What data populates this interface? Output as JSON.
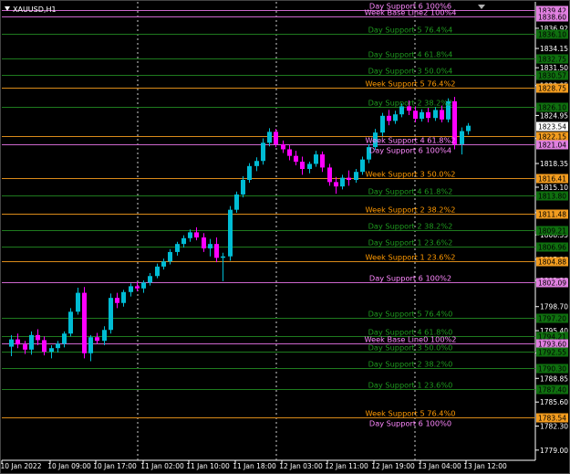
{
  "window": {
    "symbol_title": "XAUUSD,H1"
  },
  "colors": {
    "background": "#000000",
    "bull_candle": "#00bcd4",
    "bear_candle": "#ff00ff",
    "grid_vertical": "#cfcfcf",
    "axis_text": "#ffffff",
    "day_level": "#1e7a1e",
    "day_label": "#1f9a1f",
    "week_level": "#d98a1a",
    "week_label": "#ff9900",
    "day6_level": "#cc66cc",
    "day6_label": "#ff88ff",
    "current_price_box": "#ffffff"
  },
  "chart_data": {
    "type": "candlestick",
    "title": "XAUUSD,H1",
    "timeframe": "H1",
    "ylim": [
      1777.6,
      1840.55
    ],
    "price_axis_ticks": [
      1836.92,
      1834.15,
      1831.5,
      1829.05,
      1824.95,
      1821.78,
      1818.35,
      1815.1,
      1811.6,
      1808.55,
      1805.2,
      1802.3,
      1798.7,
      1795.4,
      1792.35,
      1788.85,
      1785.6,
      1782.3,
      1779.0
    ],
    "time_axis_ticks": [
      "10 Jan 2022",
      "10 Jan 09:00",
      "10 Jan 17:00",
      "11 Jan 02:00",
      "11 Jan 10:00",
      "11 Jan 18:00",
      "12 Jan 03:00",
      "12 Jan 11:00",
      "12 Jan 19:00",
      "13 Jan 04:00",
      "13 Jan 12:00"
    ],
    "current_price": 1823.54,
    "levels": [
      {
        "price": 1839.42,
        "label": "Day Support 6 100%6",
        "box": "1839.42",
        "kind": "day6"
      },
      {
        "price": 1838.6,
        "label": "Week Base Line2 100%4",
        "box": "1838.60",
        "kind": "day6"
      },
      {
        "price": 1836.1,
        "label": "Day Support 5 76.4%4",
        "box": "1836.10",
        "kind": "day"
      },
      {
        "price": 1832.8,
        "label": "Day Support 4 61.8%4",
        "box": "1832.75",
        "kind": "day"
      },
      {
        "price": 1830.5,
        "label": "Day Support 3 50.0%4",
        "box": "1830.57",
        "kind": "day"
      },
      {
        "price": 1828.75,
        "label": "Week Support 5 76.4%2",
        "box": "1828.75",
        "kind": "week"
      },
      {
        "price": 1826.1,
        "label": "Day Support 2 38.2%2",
        "box": "1826.10",
        "kind": "day"
      },
      {
        "price": 1822.15,
        "label": "",
        "box": "1822.15",
        "kind": "week"
      },
      {
        "price": 1821.04,
        "label": "Week Support 4 61.8%2",
        "box": "1821.04",
        "kind": "day6",
        "extra_label": "Day Support 6 100%4"
      },
      {
        "price": 1816.41,
        "label": "Week Support 3 50.0%2",
        "box": "1816.41",
        "kind": "week"
      },
      {
        "price": 1814.0,
        "label": "Day Support 4 61.8%2",
        "box": "1813.80",
        "kind": "day"
      },
      {
        "price": 1811.48,
        "label": "Week Support 2 38.2%2",
        "box": "1811.48",
        "kind": "week"
      },
      {
        "price": 1809.2,
        "label": "Day Support 2 38.2%2",
        "box": "1809.21",
        "kind": "day"
      },
      {
        "price": 1806.9,
        "label": "Day Support 1 23.6%2",
        "box": "1806.96",
        "kind": "day"
      },
      {
        "price": 1804.88,
        "label": "Week Support 1 23.6%2",
        "box": "1804.88",
        "kind": "week"
      },
      {
        "price": 1802.09,
        "label": "Day Support 6 100%2",
        "box": "1802.09",
        "kind": "day6"
      },
      {
        "price": 1797.2,
        "label": "Day Support 5 76.4%0",
        "box": "1797.20",
        "kind": "day"
      },
      {
        "price": 1794.7,
        "label": "Day Support 4 61.8%0",
        "box": "1794.21",
        "kind": "day"
      },
      {
        "price": 1793.6,
        "label": "Week Base Line0 100%2",
        "box": "1793.60",
        "kind": "day6"
      },
      {
        "price": 1792.5,
        "label": "Day Support 3 50.0%0",
        "box": "1792.55",
        "kind": "day"
      },
      {
        "price": 1790.3,
        "label": "Day Support 2 38.2%0",
        "box": "1790.30",
        "kind": "day"
      },
      {
        "price": 1787.4,
        "label": "Day Support 1 23.6%0",
        "box": "1787.40",
        "kind": "day"
      },
      {
        "price": 1783.54,
        "label": "Week Support 5 76.4%0",
        "box": "1783.54",
        "kind": "week",
        "extra_label": "Day Support 6 100%0"
      }
    ],
    "candles": [
      [
        1793.2,
        1794.8,
        1791.9,
        1794.2
      ],
      [
        1794.2,
        1795.0,
        1793.0,
        1793.5
      ],
      [
        1793.5,
        1794.0,
        1792.2,
        1792.8
      ],
      [
        1792.8,
        1795.3,
        1792.1,
        1794.8
      ],
      [
        1794.8,
        1795.6,
        1793.4,
        1794.1
      ],
      [
        1794.1,
        1794.6,
        1792.0,
        1792.5
      ],
      [
        1792.5,
        1793.4,
        1791.6,
        1793.0
      ],
      [
        1793.0,
        1794.0,
        1792.4,
        1793.6
      ],
      [
        1793.6,
        1795.3,
        1793.1,
        1795.0
      ],
      [
        1795.0,
        1798.5,
        1794.6,
        1798.0
      ],
      [
        1798.0,
        1801.3,
        1797.6,
        1800.6
      ],
      [
        1800.6,
        1801.4,
        1791.6,
        1792.3
      ],
      [
        1792.3,
        1794.8,
        1791.2,
        1794.5
      ],
      [
        1794.5,
        1795.1,
        1793.6,
        1794.0
      ],
      [
        1794.0,
        1796.0,
        1793.4,
        1795.5
      ],
      [
        1795.5,
        1800.5,
        1795.0,
        1799.9
      ],
      [
        1799.9,
        1800.6,
        1798.5,
        1799.2
      ],
      [
        1799.2,
        1801.0,
        1798.7,
        1800.7
      ],
      [
        1800.7,
        1801.9,
        1800.1,
        1801.5
      ],
      [
        1801.5,
        1802.1,
        1800.8,
        1801.2
      ],
      [
        1801.2,
        1802.3,
        1800.6,
        1802.0
      ],
      [
        1802.0,
        1803.3,
        1801.6,
        1802.9
      ],
      [
        1802.9,
        1804.6,
        1802.6,
        1804.2
      ],
      [
        1804.2,
        1805.3,
        1803.8,
        1804.9
      ],
      [
        1804.9,
        1806.6,
        1804.5,
        1806.2
      ],
      [
        1806.2,
        1807.6,
        1805.7,
        1807.3
      ],
      [
        1807.3,
        1808.5,
        1806.8,
        1808.1
      ],
      [
        1808.1,
        1809.3,
        1807.6,
        1808.9
      ],
      [
        1808.9,
        1809.6,
        1807.8,
        1808.2
      ],
      [
        1808.2,
        1808.8,
        1806.2,
        1806.7
      ],
      [
        1806.7,
        1808.0,
        1805.6,
        1807.3
      ],
      [
        1807.3,
        1808.2,
        1804.8,
        1805.4
      ],
      [
        1805.4,
        1806.1,
        1802.2,
        1805.6
      ],
      [
        1805.6,
        1812.5,
        1805.0,
        1812.0
      ],
      [
        1812.0,
        1814.5,
        1811.6,
        1814.1
      ],
      [
        1814.1,
        1816.6,
        1813.7,
        1816.1
      ],
      [
        1816.1,
        1818.4,
        1815.7,
        1818.0
      ],
      [
        1818.0,
        1819.2,
        1817.3,
        1818.7
      ],
      [
        1818.7,
        1821.8,
        1818.2,
        1821.2
      ],
      [
        1821.2,
        1823.2,
        1820.7,
        1822.7
      ],
      [
        1822.7,
        1823.1,
        1820.6,
        1821.0
      ],
      [
        1821.0,
        1821.5,
        1819.8,
        1820.3
      ],
      [
        1820.3,
        1820.9,
        1818.8,
        1819.4
      ],
      [
        1819.4,
        1820.1,
        1818.1,
        1818.6
      ],
      [
        1818.6,
        1819.3,
        1816.8,
        1817.6
      ],
      [
        1817.6,
        1818.6,
        1817.0,
        1818.3
      ],
      [
        1818.3,
        1820.1,
        1817.9,
        1819.6
      ],
      [
        1819.6,
        1820.0,
        1817.2,
        1817.8
      ],
      [
        1817.8,
        1818.3,
        1815.3,
        1815.8
      ],
      [
        1815.8,
        1816.5,
        1814.2,
        1815.2
      ],
      [
        1815.2,
        1816.8,
        1814.8,
        1816.4
      ],
      [
        1816.4,
        1817.4,
        1815.3,
        1816.1
      ],
      [
        1816.1,
        1817.6,
        1815.7,
        1817.2
      ],
      [
        1817.2,
        1819.3,
        1816.8,
        1818.9
      ],
      [
        1818.9,
        1821.0,
        1818.4,
        1820.6
      ],
      [
        1820.6,
        1823.1,
        1820.2,
        1822.6
      ],
      [
        1822.6,
        1825.3,
        1822.1,
        1824.9
      ],
      [
        1824.9,
        1825.7,
        1823.6,
        1824.2
      ],
      [
        1824.2,
        1825.6,
        1823.8,
        1825.1
      ],
      [
        1825.1,
        1826.6,
        1824.7,
        1826.2
      ],
      [
        1826.2,
        1827.0,
        1825.0,
        1825.6
      ],
      [
        1825.6,
        1826.2,
        1824.0,
        1824.5
      ],
      [
        1824.5,
        1825.8,
        1824.1,
        1825.4
      ],
      [
        1825.4,
        1826.0,
        1824.0,
        1824.6
      ],
      [
        1824.6,
        1826.1,
        1824.2,
        1825.7
      ],
      [
        1825.7,
        1826.3,
        1824.0,
        1824.4
      ],
      [
        1824.4,
        1827.3,
        1824.0,
        1826.9
      ],
      [
        1826.9,
        1827.5,
        1820.3,
        1821.0
      ],
      [
        1821.0,
        1823.3,
        1819.6,
        1822.8
      ],
      [
        1822.8,
        1823.9,
        1822.3,
        1823.54
      ]
    ]
  }
}
